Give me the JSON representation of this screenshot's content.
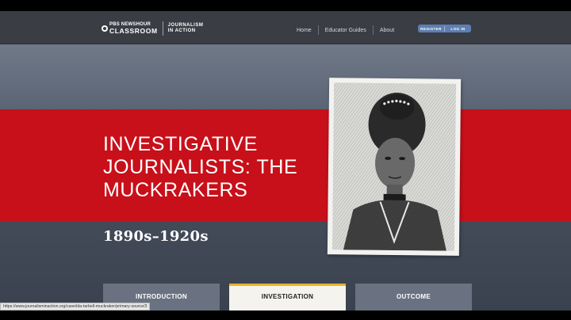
{
  "header": {
    "logo_top": "PBS NEWSHOUR",
    "logo_bottom": "CLASSROOM",
    "logo_sub1": "JOURNALISM",
    "logo_sub2": "IN ACTION",
    "nav": [
      "Home",
      "Educator Guides",
      "About"
    ],
    "register_label": "REGISTER",
    "login_label": "LOG IN"
  },
  "hero": {
    "title": "INVESTIGATIVE JOURNALISTS: THE MUCKRAKERS",
    "dates": "1890s–1920s"
  },
  "tabs": [
    {
      "label": "INTRODUCTION",
      "active": false
    },
    {
      "label": "INVESTIGATION",
      "active": true
    },
    {
      "label": "OUTCOME",
      "active": false
    }
  ],
  "status_url": "https://www.journalisminaction.org/case/ida-tarbell-muckraker/primary-source/3",
  "colors": {
    "red_band": "#c8101a",
    "tab_active_accent": "#e8b52a",
    "auth_button": "#5d7fb2"
  }
}
